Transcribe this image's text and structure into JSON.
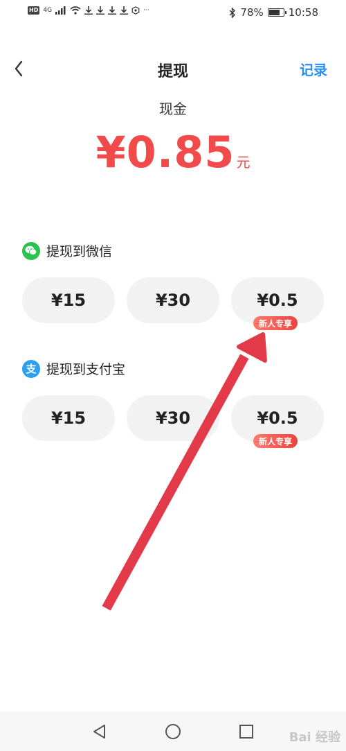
{
  "status_bar": {
    "hd": "HD",
    "network": "4G",
    "more": "···",
    "battery": "78%",
    "battery_level": 0.78,
    "time": "10:58"
  },
  "header": {
    "title": "提现",
    "records_link": "记录"
  },
  "balance": {
    "label": "现金",
    "amount": "¥0.85",
    "unit": "元"
  },
  "sections": [
    {
      "title": "提现到微信",
      "icon": "wechat-icon",
      "options": [
        {
          "amount": "¥15",
          "badge": ""
        },
        {
          "amount": "¥30",
          "badge": ""
        },
        {
          "amount": "¥0.5",
          "badge": "新人专享"
        }
      ]
    },
    {
      "title": "提现到支付宝",
      "icon": "alipay-icon",
      "icon_char": "支",
      "options": [
        {
          "amount": "¥15",
          "badge": ""
        },
        {
          "amount": "¥30",
          "badge": ""
        },
        {
          "amount": "¥0.5",
          "badge": "新人专享"
        }
      ]
    }
  ],
  "watermark": "Bai 经验",
  "colors": {
    "accent_red": "#f04a4a",
    "link_blue": "#2a8ef0",
    "wechat_green": "#2bc24d",
    "alipay_blue": "#2d9ff0",
    "annotation_arrow": "#e23a48"
  }
}
